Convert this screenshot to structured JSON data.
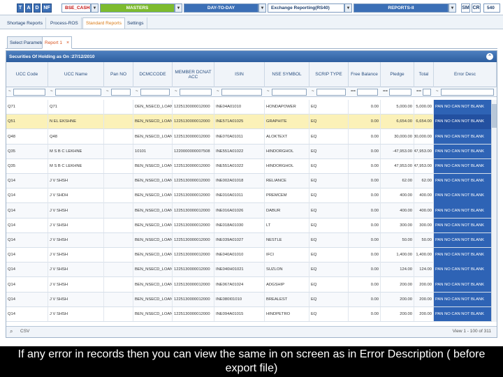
{
  "toolbar": {
    "buttons": [
      "T",
      "A",
      "D",
      "NF"
    ],
    "segment": "BSE_CASH",
    "menus": [
      "MASTERS",
      "DAY-TO-DAY",
      "Exchange Reporting(RS40)",
      "REPORTS-II"
    ],
    "right_buttons": [
      "SM",
      "CR"
    ],
    "right_field": "540"
  },
  "subtabs": [
    "Shortage Reports",
    "Process-ROS",
    "Standard Reports",
    "Settings"
  ],
  "subtabs_active": 2,
  "inner_tabs": {
    "select": "Select Parameter",
    "report": "Report 1",
    "close": "×"
  },
  "grid": {
    "caption": "Securities Of Holding as On :27/12/2010",
    "headers": [
      "UCC Code",
      "UCC Name",
      "Pan NO",
      "DCMCCODE",
      "MEMBER DCNAT ACC",
      "ISIN",
      "NSE SYMBOL",
      "SCRIP TYPE",
      "Free Balance",
      "Pledge",
      "Total",
      "Error Desc"
    ],
    "filter_ops": [
      "~",
      "~",
      "~",
      "~",
      "~",
      "~",
      "~",
      "~",
      "==",
      "==",
      "==",
      "~"
    ],
    "rows": [
      [
        "Q71",
        "Q71",
        "",
        "DEN_NSECD_LOAN",
        "1225130000012000",
        "INE04A01010",
        "HONDAPOWER",
        "EQ",
        "0.00",
        "5,000.00",
        "5,000.00",
        "PAN NO CAN NOT BLANK"
      ],
      [
        "Q51",
        "N EL EKSHNE",
        "",
        "BEN_NSECD_LOAN",
        "1225130000012000",
        "INE571A01025",
        "GRAPHITE",
        "EQ",
        "0.00",
        "6,654.00",
        "6,654.00",
        "PAN NO CAN NOT BLANK"
      ],
      [
        "Q48",
        "Q48",
        "",
        "BEN_NSECD_LOAN",
        "1225130000012000",
        "INE070A01011",
        "ALOKTEXT",
        "EQ",
        "0.00",
        "30,000.00",
        "30,000.00",
        "PAN NO CAN NOT BLANK"
      ],
      [
        "Q35",
        "M S B C LEKHNE",
        "",
        "10101",
        "1220000000007508",
        "INE551A01022",
        "HINDORGHOL",
        "EQ",
        "0.00",
        "-47,953.00",
        "-47,953.00",
        "PAN NO CAN NOT BLANK"
      ],
      [
        "Q35",
        "M S B C LEKHNE",
        "",
        "BEN_NSECD_LOAN",
        "1225130000012000",
        "INE551A01022",
        "HINDORGHOL",
        "EQ",
        "0.00",
        "47,953.00",
        "47,953.00",
        "PAN NO CAN NOT BLANK"
      ],
      [
        "Q14",
        "J V SHSH",
        "",
        "BEN_NSECD_LOAN",
        "1225130000012000",
        "INE002A01018",
        "RELIANCE",
        "EQ",
        "0.00",
        "62.00",
        "62.00",
        "PAN NO CAN NOT BLANK"
      ],
      [
        "Q14",
        "J V SHDH",
        "",
        "BEN_NSECD_LOAN",
        "1225130000012000",
        "INE010A01011",
        "PREMCEM",
        "EQ",
        "0.00",
        "400.00",
        "400.00",
        "PAN NO CAN NOT BLANK"
      ],
      [
        "Q14",
        "J V SHSH",
        "",
        "BEN_NSECD_LOAN",
        "1225130000012000",
        "INE016A01026",
        "DABUR",
        "EQ",
        "0.00",
        "400.00",
        "400.00",
        "PAN NO CAN NOT BLANK"
      ],
      [
        "Q14",
        "J V SHSH",
        "",
        "BEN_NSECD_LOAN",
        "1225130000012000",
        "INE018A01030",
        "LT",
        "EQ",
        "0.00",
        "300.00",
        "300.00",
        "PAN NO CAN NOT BLANK"
      ],
      [
        "Q14",
        "J V SHSH",
        "",
        "BEN_NSECD_LOAN",
        "1225130000012000",
        "INE039A01027",
        "NESTLE",
        "EQ",
        "0.00",
        "50.00",
        "50.00",
        "PAN NO CAN NOT BLANK"
      ],
      [
        "Q14",
        "J V SHSH",
        "",
        "BEN_NSECD_LOAN",
        "1225130000012000",
        "INE040A01010",
        "IFCI",
        "EQ",
        "0.00",
        "1,400.00",
        "1,400.00",
        "PAN NO CAN NOT BLANK"
      ],
      [
        "Q14",
        "J V SHSH",
        "",
        "BEN_NSECD_LOAN",
        "1225130000012000",
        "INE040H01021",
        "SUZLON",
        "EQ",
        "0.00",
        "124.00",
        "124.00",
        "PAN NO CAN NOT BLANK"
      ],
      [
        "Q14",
        "J V SHSH",
        "",
        "BEN_NSECD_LOAN",
        "1225130000012000",
        "INE067A01024",
        "ADGSHIP",
        "EQ",
        "0.00",
        "200.00",
        "200.00",
        "PAN NO CAN NOT BLANK"
      ],
      [
        "Q14",
        "J V SHSH",
        "",
        "BEN_NSECD_LOAN",
        "1225130000012000",
        "INE080I01010",
        "BREALEST",
        "EQ",
        "0.00",
        "200.00",
        "200.00",
        "PAN NO CAN NOT BLANK"
      ],
      [
        "Q14",
        "J V SHSH",
        "",
        "BEN_NSECD_LOAN",
        "1225130000012000",
        "INE094A01015",
        "HINDPETRO",
        "EQ",
        "0.00",
        "200.00",
        "200.00",
        "PAN NO CAN NOT BLANK"
      ]
    ],
    "selected_row": 1
  },
  "pager": {
    "export": "CSV",
    "view": "View 1 - 100 of 311"
  },
  "overlay_message": "If any error in records then you can view the same in on screen as in Error Description ( before export file)",
  "colors": {
    "masters_green": "#7dbb2f",
    "menu_blue": "#3b6fb6",
    "error_blue": "#2e63b5",
    "selected_row": "#fbf1b8"
  }
}
